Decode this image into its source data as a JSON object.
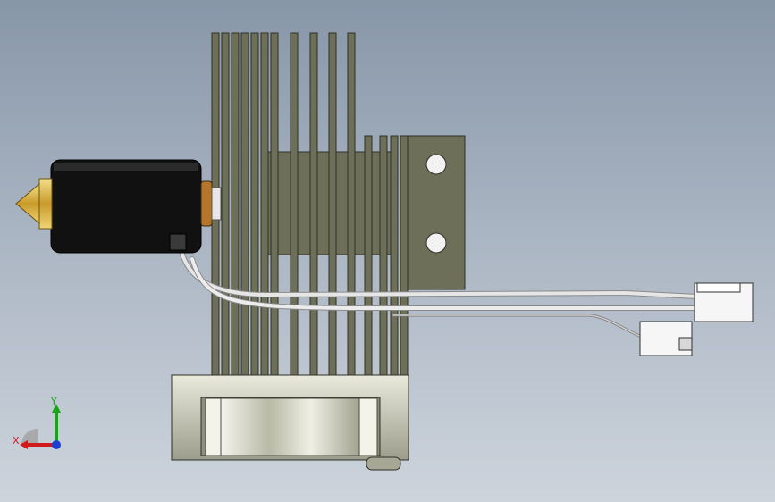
{
  "viewport": {
    "background_top": "#8796a8",
    "background_bottom": "#cdd4dc"
  },
  "model": {
    "parts": [
      "heatsink",
      "fan-shroud",
      "fan",
      "heater-block",
      "nozzle",
      "mounting-plate",
      "wire-harness",
      "connector-large",
      "connector-small"
    ],
    "colors": {
      "heatsink": "#6e6f58",
      "heatsink_edge": "#2f3026",
      "heater_block": "#111111",
      "nozzle": "#d9b84a",
      "fan_shroud": "#c9c9b8",
      "fan_blades": "#b8b8a8",
      "wire": "#dcdcdc",
      "connector": "#f5f5f5"
    }
  },
  "triad": {
    "x_label": "X",
    "y_label": "Y",
    "x_color": "#d11a1a",
    "y_color": "#1aa31a",
    "z_color": "#1a3fd1"
  }
}
